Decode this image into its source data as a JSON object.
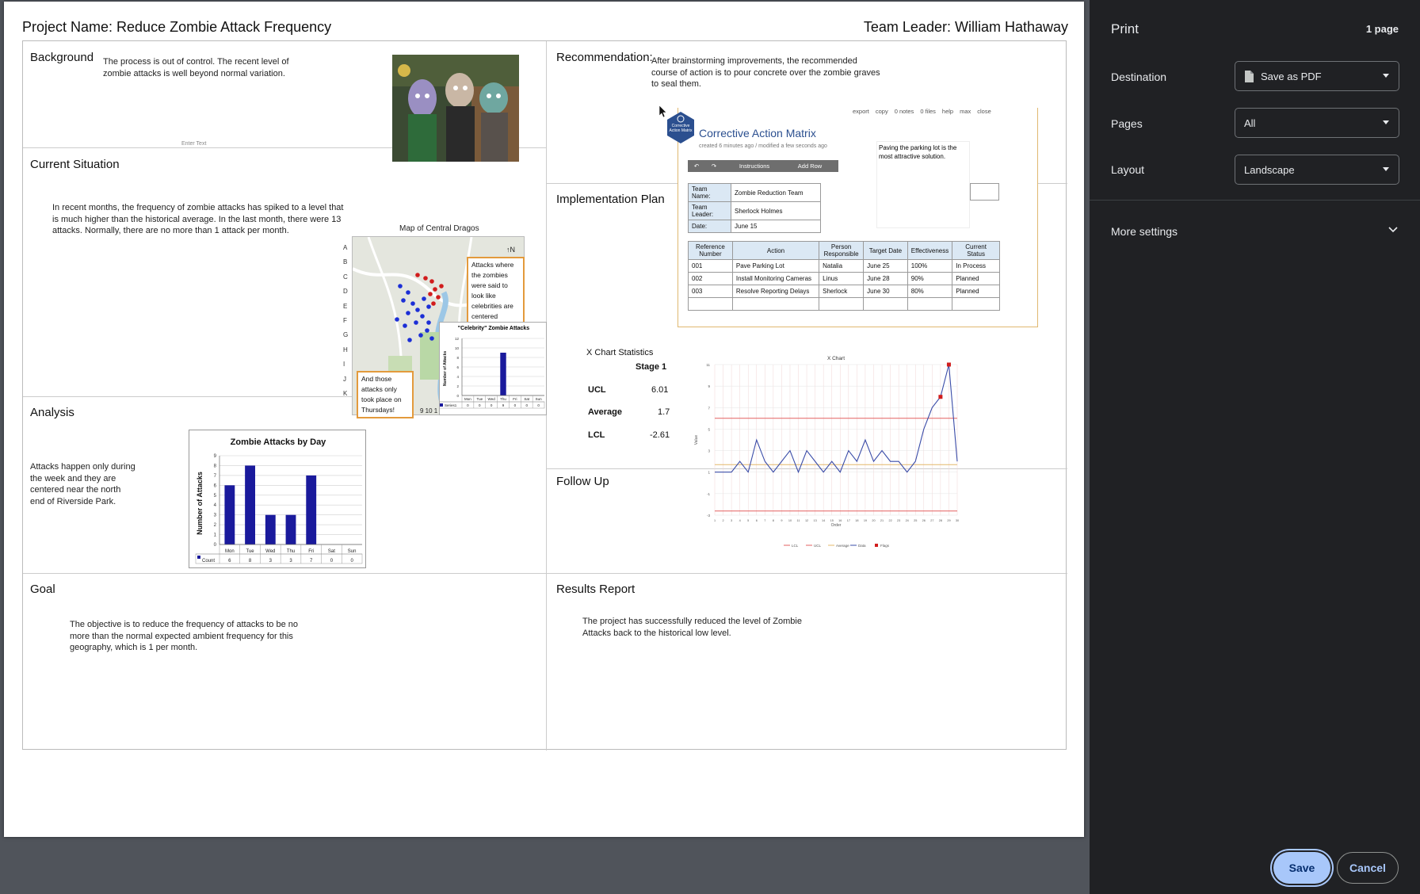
{
  "page": {
    "header_left": "Project Name: Reduce Zombie Attack Frequency",
    "header_right": "Team Leader: William Hathaway"
  },
  "background": {
    "title": "Background",
    "text": "The process is out of control.  The recent level of zombie attacks is well beyond normal variation.",
    "placeholder": "Enter Text"
  },
  "current_situation": {
    "title": "Current Situation",
    "text": "In recent months, the frequency of zombie attacks has spiked to a level that is much higher than the historical average.  In the last month, there were 13 attacks. Normally, there are no more than 1 attack per month.",
    "map_title": "Map of Central Dragos",
    "map_rows": [
      "A",
      "B",
      "C",
      "D",
      "E",
      "F",
      "G",
      "H",
      "I",
      "J",
      "K"
    ],
    "north_label": "↑N",
    "callout_celebrity": "Attacks where the zombies were said to look like celebrities are centered around the mask factory.",
    "callout_thursday": "And those attacks only took place on Thursdays!",
    "map_bottom_numbers": "9 10 1",
    "inset_title": "\"Celebrity\" Zombie Attacks",
    "inset_ylabel": "Number of Attacks",
    "inset_yticks": [
      "12",
      "10",
      "8",
      "6",
      "4",
      "2",
      "0"
    ]
  },
  "analysis": {
    "title": "Analysis",
    "text": "Attacks happen only during the week and they are centered near the north end of Riverside Park."
  },
  "goal": {
    "title": "Goal",
    "text": "The objective is to reduce the frequency of attacks to be no more than the normal expected ambient frequency for this geography, which is 1 per month."
  },
  "recommendation": {
    "title": "Recommendation:",
    "text": "After brainstorming improvements, the recommended course of action is to pour concrete over the zombie graves to seal them."
  },
  "implementation": {
    "title": "Implementation Plan"
  },
  "follow_up": {
    "title": "Follow Up"
  },
  "results": {
    "title": "Results Report",
    "text": "The project has successfully reduced the level of Zombie Attacks back to the historical low level."
  },
  "cam": {
    "badge": "Corrective Action Matrix",
    "title": "Corrective Action Matrix",
    "subtitle": "created 6 minutes ago / modified a few seconds ago",
    "toolbar": {
      "export": "export",
      "copy": "copy",
      "notes": "0 notes",
      "files": "0 files",
      "help": "help",
      "max": "max",
      "close": "close"
    },
    "buttons": {
      "undo": "↶",
      "redo": "↷",
      "instructions": "Instructions",
      "add_row": "Add Row"
    },
    "note": "Paving the parking lot is the most attractive solution.",
    "team_name_label": "Team Name:",
    "team_name": "Zombie Reduction Team",
    "team_leader_label": "Team Leader:",
    "team_leader": "Sherlock Holmes",
    "date_label": "Date:",
    "date": "June 15",
    "columns": [
      "Reference Number",
      "Action",
      "Person Responsible",
      "Target Date",
      "Effectiveness",
      "Current Status"
    ],
    "rows": [
      [
        "001",
        "Pave Parking Lot",
        "Natalia",
        "June 25",
        "100%",
        "In Process"
      ],
      [
        "002",
        "Install Monitoring Cameras",
        "Linus",
        "June 28",
        "90%",
        "Planned"
      ],
      [
        "003",
        "Resolve Reporting Delays",
        "Sherlock",
        "June 30",
        "80%",
        "Planned"
      ]
    ]
  },
  "xstats": {
    "title": "X Chart Statistics",
    "stage": "Stage 1",
    "ucl_label": "UCL",
    "ucl": "6.01",
    "avg_label": "Average",
    "avg": "1.7",
    "lcl_label": "LCL",
    "lcl": "-2.61"
  },
  "sidebar": {
    "title": "Print",
    "pages_count": "1 page",
    "destination_label": "Destination",
    "destination_value": "Save as PDF",
    "pages_label": "Pages",
    "pages_value": "All",
    "layout_label": "Layout",
    "layout_value": "Landscape",
    "more_settings": "More settings",
    "save": "Save",
    "cancel": "Cancel"
  },
  "colors": {
    "bar_blue": "#1a1a9c",
    "accent_blue": "#8ab4f8",
    "sidebar_bg": "#202124",
    "callout_orange": "#e39a3c"
  },
  "chart_data": [
    {
      "type": "bar",
      "title": "Zombie Attacks by Day",
      "ylabel": "Number of Attacks",
      "xlabel": "",
      "categories": [
        "Mon",
        "Tue",
        "Wed",
        "Thu",
        "Fri",
        "Sat",
        "Sun"
      ],
      "series": [
        {
          "name": "Count",
          "values": [
            6,
            8,
            3,
            3,
            7,
            0,
            0
          ]
        }
      ],
      "ylim": [
        0,
        9
      ],
      "yticks": [
        "0",
        "1",
        "2",
        "3",
        "4",
        "5",
        "6",
        "7",
        "8",
        "9"
      ],
      "legend": "bottom-left",
      "grid": true
    },
    {
      "type": "bar",
      "title": "\"Celebrity\" Zombie Attacks",
      "ylabel": "Number of Attacks",
      "categories": [
        "Mon",
        "Tue",
        "Wed",
        "Thu",
        "Fri",
        "Sat",
        "Sun"
      ],
      "series": [
        {
          "name": "Series1",
          "values": [
            0,
            0,
            0,
            9,
            0,
            0,
            0
          ]
        }
      ],
      "ylim": [
        0,
        12
      ],
      "grid": true
    },
    {
      "type": "line",
      "title": "X Chart",
      "xlabel": "Order",
      "ylabel": "Value",
      "x": [
        1,
        2,
        3,
        4,
        5,
        6,
        7,
        8,
        9,
        10,
        11,
        12,
        13,
        14,
        15,
        16,
        17,
        18,
        19,
        20,
        21,
        22,
        23,
        24,
        25,
        26,
        27,
        28,
        29,
        30
      ],
      "series": [
        {
          "name": "Data",
          "values": [
            1,
            1,
            1,
            2,
            1,
            4,
            2,
            1,
            2,
            3,
            1,
            3,
            2,
            1,
            2,
            1,
            3,
            2,
            4,
            2,
            3,
            2,
            2,
            1,
            2,
            5,
            7,
            8,
            11,
            2
          ]
        },
        {
          "name": "UCL",
          "values": [
            6.01
          ]
        },
        {
          "name": "Average",
          "values": [
            1.7
          ]
        },
        {
          "name": "LCL",
          "values": [
            -2.61
          ]
        }
      ],
      "flags_x": [
        28,
        29
      ],
      "xticks": [
        "1",
        "2",
        "3",
        "4",
        "5",
        "6",
        "7",
        "8",
        "9",
        "10",
        "11",
        "12",
        "13",
        "14",
        "15",
        "16",
        "17",
        "18",
        "19",
        "20",
        "21",
        "22",
        "23",
        "24",
        "25",
        "26",
        "27",
        "28",
        "29",
        "30"
      ],
      "yticks": [
        "11",
        "9",
        "7",
        "5",
        "3",
        "1",
        "-1",
        "-3"
      ],
      "legend": [
        "LCL",
        "UCL",
        "Average",
        "Data",
        "Flags"
      ],
      "legend_position": "bottom",
      "ylim": [
        -3,
        11
      ]
    }
  ]
}
